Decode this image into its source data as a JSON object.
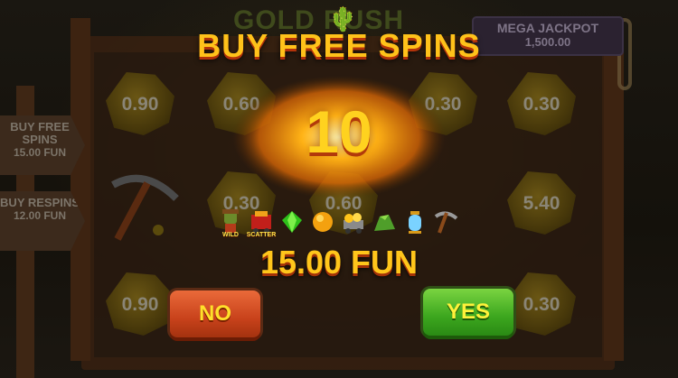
{
  "game": {
    "logo": "GOLD RUSH"
  },
  "jackpot": {
    "title": "MEGA JACKPOT",
    "value": "1,500.00"
  },
  "reel_cells": [
    {
      "value": "0.90"
    },
    {
      "value": "0.60"
    },
    {
      "value": "0.30"
    },
    {
      "value": "0.30"
    },
    {
      "value": "0.30"
    },
    {
      "value": "0.60"
    },
    {
      "value": "5.40"
    },
    {
      "value": "0.90"
    },
    {
      "value": "0.30"
    }
  ],
  "side_signs": [
    {
      "title": "BUY FREE SPINS",
      "price": "15.00 FUN"
    },
    {
      "title": "BUY RESPINS",
      "price": "12.00 FUN"
    }
  ],
  "modal": {
    "title": "BUY FREE SPINS",
    "spins": "10",
    "price": "15.00 FUN",
    "no_label": "NO",
    "yes_label": "YES"
  },
  "symbols": [
    {
      "icon": "wild-miner-icon",
      "label": "WILD"
    },
    {
      "icon": "scatter-cart-icon",
      "label": "SCATTER"
    },
    {
      "icon": "green-gem-icon",
      "label": ""
    },
    {
      "icon": "gold-nugget-icon",
      "label": ""
    },
    {
      "icon": "ore-cart-icon",
      "label": ""
    },
    {
      "icon": "green-ore-icon",
      "label": ""
    },
    {
      "icon": "lantern-icon",
      "label": ""
    },
    {
      "icon": "pickaxe-icon",
      "label": ""
    }
  ],
  "colors": {
    "title": "#ffc21a",
    "no_button": "#c8421b",
    "yes_button": "#3ca61e"
  }
}
